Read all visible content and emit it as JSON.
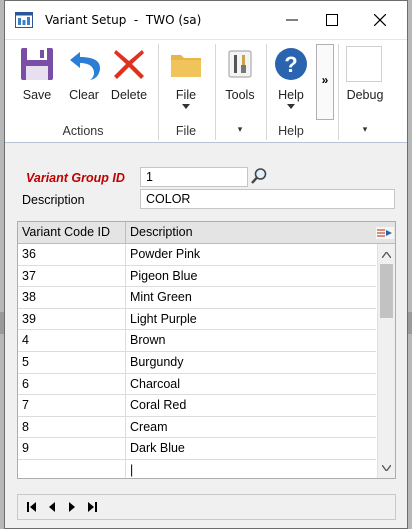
{
  "window": {
    "title": "Variant Setup  -  TWO (sa)"
  },
  "ribbon": {
    "buttons": {
      "save": "Save",
      "clear": "Clear",
      "delete": "Delete",
      "file": "File",
      "tools": "Tools",
      "help": "Help",
      "debug": "Debug"
    },
    "overflow": "»",
    "groups": {
      "actions": "Actions",
      "file": "File",
      "help": "Help"
    }
  },
  "form": {
    "variant_group_label": "Variant Group ID",
    "variant_group_value": "1",
    "description_label": "Description",
    "description_value": "COLOR"
  },
  "grid": {
    "headers": {
      "code": "Variant Code ID",
      "description": "Description"
    },
    "rows": [
      {
        "code": "36",
        "description": "Powder Pink"
      },
      {
        "code": "37",
        "description": "Pigeon Blue"
      },
      {
        "code": "38",
        "description": "Mint Green"
      },
      {
        "code": "39",
        "description": "Light Purple"
      },
      {
        "code": "4",
        "description": "Brown"
      },
      {
        "code": "5",
        "description": "Burgundy"
      },
      {
        "code": "6",
        "description": "Charcoal"
      },
      {
        "code": "7",
        "description": "Coral Red"
      },
      {
        "code": "8",
        "description": "Cream"
      },
      {
        "code": "9",
        "description": "Dark Blue"
      },
      {
        "code": "",
        "description": "|"
      }
    ]
  },
  "icons": {
    "app": "app-grid-icon",
    "lookup": "magnifier-icon",
    "expand": "expand-grid-icon"
  },
  "colors": {
    "required_label": "#c00000",
    "accent_blue": "#2a64b0",
    "delete_red": "#e0301e"
  }
}
